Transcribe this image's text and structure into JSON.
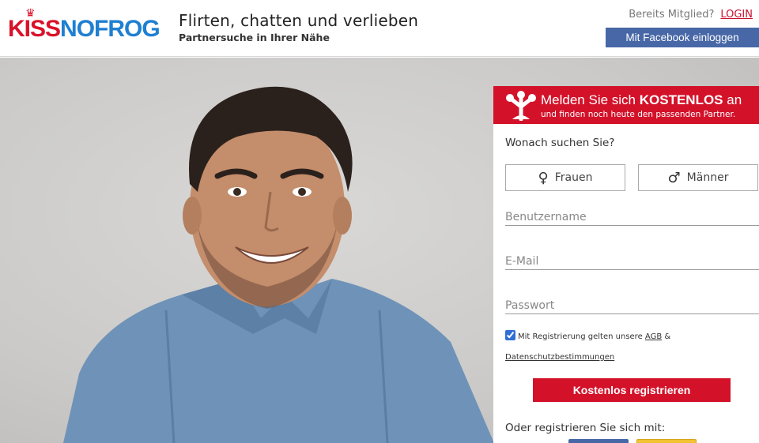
{
  "header": {
    "logo_kiss": "KISS",
    "logo_nofrog": "NOFROG",
    "tagline_title": "Flirten, chatten und verlieben",
    "tagline_sub": "Partnersuche in Ihrer Nähe",
    "member_text": "Bereits Mitglied?",
    "login_label": "LOGIN",
    "facebook_label": "Mit Facebook einloggen"
  },
  "panel": {
    "heading_prefix": "Melden Sie sich ",
    "heading_emph": "KOSTENLOS",
    "heading_suffix": " an",
    "subheading": "und finden noch heute den passenden Partner.",
    "question": "Wonach suchen Sie?",
    "women_label": "Frauen",
    "men_label": "Männer",
    "username_placeholder": "Benutzername",
    "email_placeholder": "E-Mail",
    "password_placeholder": "Passwort",
    "terms_prefix": "Mit Registrierung gelten unsere ",
    "terms_agb": "AGB",
    "terms_amp": " &",
    "terms_privacy": "Datenschutzbestimmungen",
    "terms_checked": true,
    "register_label": "Kostenlos registrieren",
    "alt_text": "Oder registrieren Sie sich mit:"
  },
  "colors": {
    "brand_red": "#d3122a",
    "brand_blue": "#1f7fd1",
    "facebook": "#4767a6"
  },
  "icons": {
    "women": "female-symbol",
    "men": "male-symbol",
    "panel": "frog-foot-icon",
    "logo": "crown-icon"
  }
}
